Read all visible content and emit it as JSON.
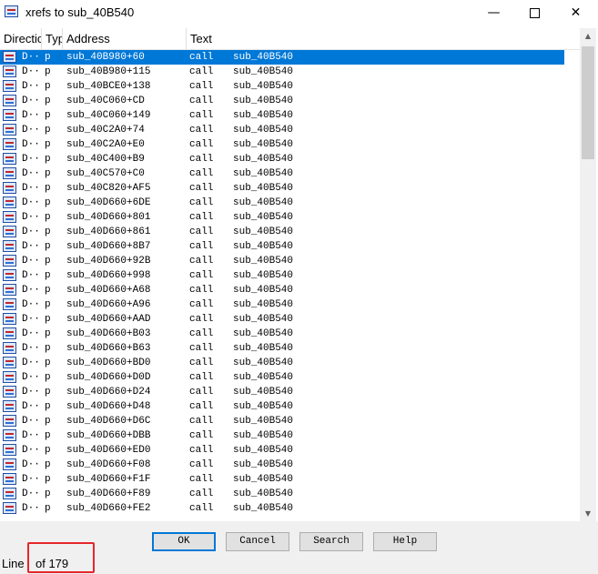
{
  "window": {
    "title": "xrefs to sub_40B540",
    "icon": "xrefs-window-icon",
    "minimize_glyph": "—",
    "close_glyph": "✕"
  },
  "columns": [
    {
      "label": "Direction"
    },
    {
      "label": "Type"
    },
    {
      "label": "Address"
    },
    {
      "label": "Text"
    }
  ],
  "rows": [
    {
      "dir": "D···",
      "type": "p",
      "address": "sub_40B980+60",
      "text": "call",
      "target": "sub_40B540"
    },
    {
      "dir": "D···",
      "type": "p",
      "address": "sub_40B980+115",
      "text": "call",
      "target": "sub_40B540"
    },
    {
      "dir": "D···",
      "type": "p",
      "address": "sub_40BCE0+138",
      "text": "call",
      "target": "sub_40B540"
    },
    {
      "dir": "D···",
      "type": "p",
      "address": "sub_40C060+CD",
      "text": "call",
      "target": "sub_40B540"
    },
    {
      "dir": "D···",
      "type": "p",
      "address": "sub_40C060+149",
      "text": "call",
      "target": "sub_40B540"
    },
    {
      "dir": "D···",
      "type": "p",
      "address": "sub_40C2A0+74",
      "text": "call",
      "target": "sub_40B540"
    },
    {
      "dir": "D···",
      "type": "p",
      "address": "sub_40C2A0+E0",
      "text": "call",
      "target": "sub_40B540"
    },
    {
      "dir": "D···",
      "type": "p",
      "address": "sub_40C400+B9",
      "text": "call",
      "target": "sub_40B540"
    },
    {
      "dir": "D···",
      "type": "p",
      "address": "sub_40C570+C0",
      "text": "call",
      "target": "sub_40B540"
    },
    {
      "dir": "D···",
      "type": "p",
      "address": "sub_40C820+AF5",
      "text": "call",
      "target": "sub_40B540"
    },
    {
      "dir": "D···",
      "type": "p",
      "address": "sub_40D660+6DE",
      "text": "call",
      "target": "sub_40B540"
    },
    {
      "dir": "D···",
      "type": "p",
      "address": "sub_40D660+801",
      "text": "call",
      "target": "sub_40B540"
    },
    {
      "dir": "D···",
      "type": "p",
      "address": "sub_40D660+861",
      "text": "call",
      "target": "sub_40B540"
    },
    {
      "dir": "D···",
      "type": "p",
      "address": "sub_40D660+8B7",
      "text": "call",
      "target": "sub_40B540"
    },
    {
      "dir": "D···",
      "type": "p",
      "address": "sub_40D660+92B",
      "text": "call",
      "target": "sub_40B540"
    },
    {
      "dir": "D···",
      "type": "p",
      "address": "sub_40D660+998",
      "text": "call",
      "target": "sub_40B540"
    },
    {
      "dir": "D···",
      "type": "p",
      "address": "sub_40D660+A68",
      "text": "call",
      "target": "sub_40B540"
    },
    {
      "dir": "D···",
      "type": "p",
      "address": "sub_40D660+A96",
      "text": "call",
      "target": "sub_40B540"
    },
    {
      "dir": "D···",
      "type": "p",
      "address": "sub_40D660+AAD",
      "text": "call",
      "target": "sub_40B540"
    },
    {
      "dir": "D···",
      "type": "p",
      "address": "sub_40D660+B03",
      "text": "call",
      "target": "sub_40B540"
    },
    {
      "dir": "D···",
      "type": "p",
      "address": "sub_40D660+B63",
      "text": "call",
      "target": "sub_40B540"
    },
    {
      "dir": "D···",
      "type": "p",
      "address": "sub_40D660+BD0",
      "text": "call",
      "target": "sub_40B540"
    },
    {
      "dir": "D···",
      "type": "p",
      "address": "sub_40D660+D0D",
      "text": "call",
      "target": "sub_40B540"
    },
    {
      "dir": "D···",
      "type": "p",
      "address": "sub_40D660+D24",
      "text": "call",
      "target": "sub_40B540"
    },
    {
      "dir": "D···",
      "type": "p",
      "address": "sub_40D660+D48",
      "text": "call",
      "target": "sub_40B540"
    },
    {
      "dir": "D···",
      "type": "p",
      "address": "sub_40D660+D6C",
      "text": "call",
      "target": "sub_40B540"
    },
    {
      "dir": "D···",
      "type": "p",
      "address": "sub_40D660+DBB",
      "text": "call",
      "target": "sub_40B540"
    },
    {
      "dir": "D···",
      "type": "p",
      "address": "sub_40D660+ED0",
      "text": "call",
      "target": "sub_40B540"
    },
    {
      "dir": "D···",
      "type": "p",
      "address": "sub_40D660+F08",
      "text": "call",
      "target": "sub_40B540"
    },
    {
      "dir": "D···",
      "type": "p",
      "address": "sub_40D660+F1F",
      "text": "call",
      "target": "sub_40B540"
    },
    {
      "dir": "D···",
      "type": "p",
      "address": "sub_40D660+F89",
      "text": "call",
      "target": "sub_40B540"
    },
    {
      "dir": "D···",
      "type": "p",
      "address": "sub_40D660+FE2",
      "text": "call",
      "target": "sub_40B540"
    }
  ],
  "selected_row": 0,
  "buttons": {
    "ok": "OK",
    "cancel": "Cancel",
    "search": "Search",
    "help": "Help"
  },
  "status": {
    "label": "Line",
    "value": "of 179"
  },
  "colors": {
    "selection": "#0078d7",
    "highlight_box": "#e5262b"
  }
}
